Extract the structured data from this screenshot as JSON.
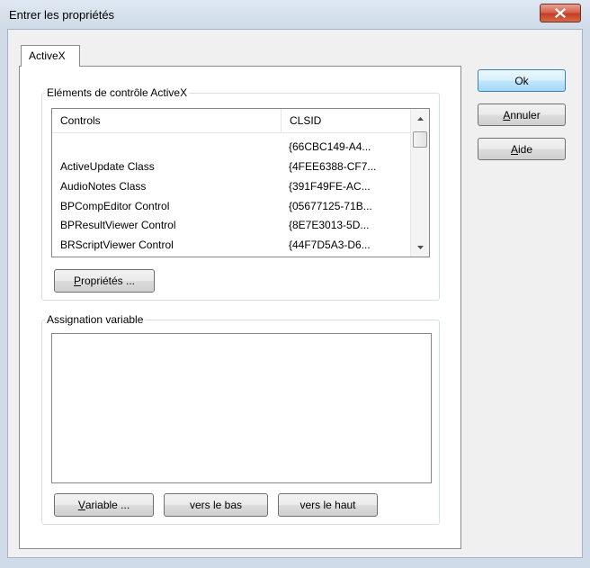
{
  "window": {
    "title": "Entrer les propriétés"
  },
  "tabs": [
    {
      "label": "ActiveX",
      "selected": true
    }
  ],
  "activex_group": {
    "label": "Eléments de contrôle ActiveX",
    "columns": [
      "Controls",
      "CLSID"
    ],
    "rows": [
      {
        "control": "",
        "clsid": "{66CBC149-A4..."
      },
      {
        "control": "ActiveUpdate Class",
        "clsid": "{4FEE6388-CF7..."
      },
      {
        "control": "AudioNotes Class",
        "clsid": "{391F49FE-AC..."
      },
      {
        "control": "BPCompEditor Control",
        "clsid": "{05677125-71B..."
      },
      {
        "control": "BPResultViewer Control",
        "clsid": "{8E7E3013-5D..."
      },
      {
        "control": "BRScriptViewer Control",
        "clsid": "{44F7D5A3-D6..."
      }
    ],
    "properties_button": {
      "accel": "P",
      "rest": "ropriétés ..."
    }
  },
  "assignment_group": {
    "label": "Assignation variable",
    "value": "",
    "variable_button": {
      "accel": "V",
      "rest": "ariable ..."
    },
    "down_button": "vers le bas",
    "up_button": "vers le haut"
  },
  "dialog_buttons": {
    "ok": "Ok",
    "cancel": {
      "accel": "A",
      "rest": "nnuler"
    },
    "help": {
      "accel": "A",
      "rest": "ide"
    }
  },
  "icons": {
    "close": "close-icon",
    "scroll_up": "scroll-up-arrow-icon",
    "scroll_down": "scroll-down-arrow-icon"
  }
}
